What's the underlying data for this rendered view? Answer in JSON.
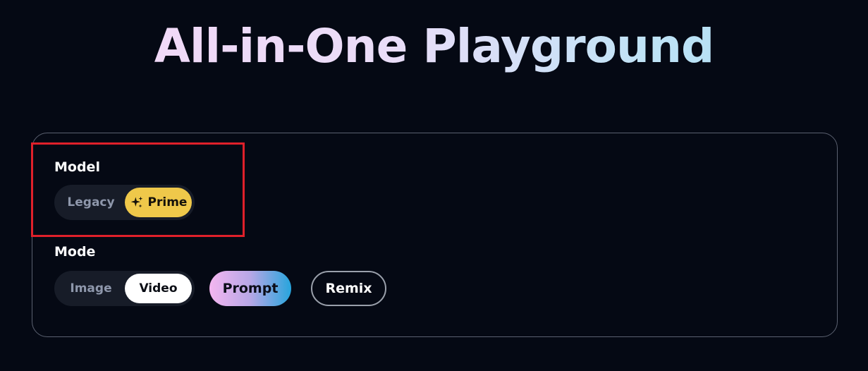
{
  "page": {
    "title": "All-in-One Playground"
  },
  "model": {
    "label": "Model",
    "options": [
      {
        "label": "Legacy",
        "selected": false
      },
      {
        "label": "Prime",
        "selected": true,
        "icon": "sparkle-icon"
      }
    ]
  },
  "mode": {
    "label": "Mode",
    "options": [
      {
        "label": "Image",
        "selected": false
      },
      {
        "label": "Video",
        "selected": true
      }
    ]
  },
  "actions": {
    "prompt_label": "Prompt",
    "remix_label": "Remix"
  },
  "colors": {
    "background": "#050914",
    "prime_accent": "#efc84a",
    "highlight_border": "#e0202a",
    "prompt_gradient_start": "#f4b6f0",
    "prompt_gradient_end": "#27a5dd"
  }
}
